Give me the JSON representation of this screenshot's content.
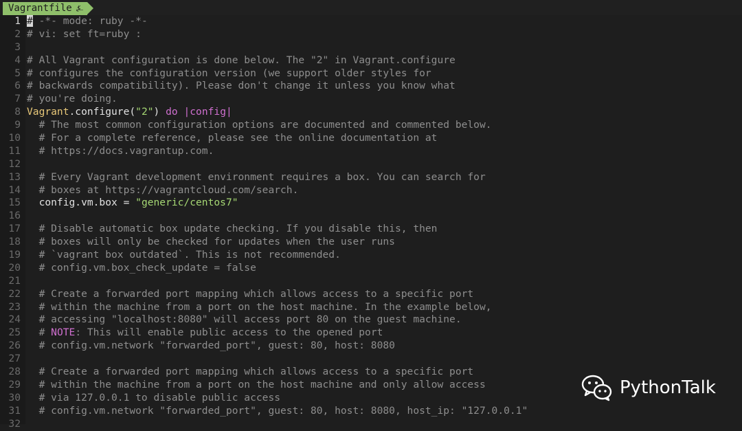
{
  "tab": {
    "title": "Vagrantfile",
    "icon": "vim-tree-icon"
  },
  "lines": [
    {
      "num": "1",
      "parts": [
        {
          "t": "#",
          "c": "cursor"
        },
        {
          "t": " -*- mode: ruby -*-",
          "c": "c-comment"
        }
      ],
      "current": true
    },
    {
      "num": "2",
      "parts": [
        {
          "t": "# vi: set ft=ruby :",
          "c": "c-comment"
        }
      ]
    },
    {
      "num": "3",
      "parts": []
    },
    {
      "num": "4",
      "parts": [
        {
          "t": "# All Vagrant configuration is done below. The \"2\" in Vagrant.configure",
          "c": "c-comment"
        }
      ]
    },
    {
      "num": "5",
      "parts": [
        {
          "t": "# configures the configuration version (we support older styles for",
          "c": "c-comment"
        }
      ]
    },
    {
      "num": "6",
      "parts": [
        {
          "t": "# backwards compatibility). Please don't change it unless you know what",
          "c": "c-comment"
        }
      ]
    },
    {
      "num": "7",
      "parts": [
        {
          "t": "# you're doing.",
          "c": "c-comment"
        }
      ]
    },
    {
      "num": "8",
      "parts": [
        {
          "t": "Vagrant",
          "c": "c-vagrant"
        },
        {
          "t": ".configure(",
          "c": "code"
        },
        {
          "t": "\"2\"",
          "c": "c-string"
        },
        {
          "t": ") ",
          "c": "code"
        },
        {
          "t": "do",
          "c": "c-keyword"
        },
        {
          "t": " ",
          "c": "code"
        },
        {
          "t": "|config|",
          "c": "c-keyword"
        }
      ]
    },
    {
      "num": "9",
      "parts": [
        {
          "t": "  # The most common configuration options are documented and commented below.",
          "c": "c-comment"
        }
      ]
    },
    {
      "num": "10",
      "parts": [
        {
          "t": "  # For a complete reference, please see the online documentation at",
          "c": "c-comment"
        }
      ]
    },
    {
      "num": "11",
      "parts": [
        {
          "t": "  # https://docs.vagrantup.com.",
          "c": "c-comment"
        }
      ]
    },
    {
      "num": "12",
      "parts": []
    },
    {
      "num": "13",
      "parts": [
        {
          "t": "  # Every Vagrant development environment requires a box. You can search for",
          "c": "c-comment"
        }
      ]
    },
    {
      "num": "14",
      "parts": [
        {
          "t": "  # boxes at https://vagrantcloud.com/search.",
          "c": "c-comment"
        }
      ]
    },
    {
      "num": "15",
      "parts": [
        {
          "t": "  config.vm.box = ",
          "c": "code"
        },
        {
          "t": "\"generic/centos7\"",
          "c": "c-string"
        }
      ]
    },
    {
      "num": "16",
      "parts": []
    },
    {
      "num": "17",
      "parts": [
        {
          "t": "  # Disable automatic box update checking. If you disable this, then",
          "c": "c-comment"
        }
      ]
    },
    {
      "num": "18",
      "parts": [
        {
          "t": "  # boxes will only be checked for updates when the user runs",
          "c": "c-comment"
        }
      ]
    },
    {
      "num": "19",
      "parts": [
        {
          "t": "  # `vagrant box outdated`. This is not recommended.",
          "c": "c-comment"
        }
      ]
    },
    {
      "num": "20",
      "parts": [
        {
          "t": "  # config.vm.box_check_update = false",
          "c": "c-comment"
        }
      ]
    },
    {
      "num": "21",
      "parts": []
    },
    {
      "num": "22",
      "parts": [
        {
          "t": "  # Create a forwarded port mapping which allows access to a specific port",
          "c": "c-comment"
        }
      ]
    },
    {
      "num": "23",
      "parts": [
        {
          "t": "  # within the machine from a port on the host machine. In the example below,",
          "c": "c-comment"
        }
      ]
    },
    {
      "num": "24",
      "parts": [
        {
          "t": "  # accessing \"localhost:8080\" will access port 80 on the guest machine.",
          "c": "c-comment"
        }
      ]
    },
    {
      "num": "25",
      "parts": [
        {
          "t": "  # ",
          "c": "c-comment"
        },
        {
          "t": "NOTE",
          "c": "c-note"
        },
        {
          "t": ": This will enable public access to the opened port",
          "c": "c-comment"
        }
      ]
    },
    {
      "num": "26",
      "parts": [
        {
          "t": "  # config.vm.network \"forwarded_port\", guest: 80, host: 8080",
          "c": "c-comment"
        }
      ]
    },
    {
      "num": "27",
      "parts": []
    },
    {
      "num": "28",
      "parts": [
        {
          "t": "  # Create a forwarded port mapping which allows access to a specific port",
          "c": "c-comment"
        }
      ]
    },
    {
      "num": "29",
      "parts": [
        {
          "t": "  # within the machine from a port on the host machine and only allow access",
          "c": "c-comment"
        }
      ]
    },
    {
      "num": "30",
      "parts": [
        {
          "t": "  # via 127.0.0.1 to disable public access",
          "c": "c-comment"
        }
      ]
    },
    {
      "num": "31",
      "parts": [
        {
          "t": "  # config.vm.network \"forwarded_port\", guest: 80, host: 8080, host_ip: \"127.0.0.1\"",
          "c": "c-comment"
        }
      ]
    },
    {
      "num": "32",
      "parts": []
    }
  ],
  "watermark": {
    "text": "PythonTalk",
    "icon": "wechat-icon"
  },
  "colors": {
    "background": "#1e1e1e",
    "tab": "#8fbf6a",
    "comment": "#8e8e8e",
    "string": "#a6d874",
    "keyword": "#d070d0",
    "constant": "#e8c879"
  }
}
